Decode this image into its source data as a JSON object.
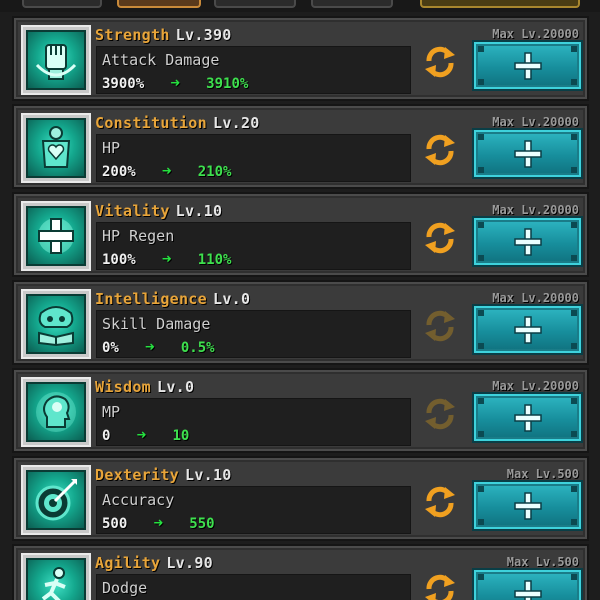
{
  "colors": {
    "stat_name": "#e8a53a",
    "next_value": "#3ee04e",
    "button": "#178e9c",
    "cycle_active": "#f0a020"
  },
  "stats": [
    {
      "name": "Strength",
      "level": "Lv.390",
      "max_level": "Max Lv.20000",
      "effect": "Attack Damage",
      "current": "3900%",
      "next": "3910%",
      "icon": "fist-icon",
      "cycle_active": true
    },
    {
      "name": "Constitution",
      "level": "Lv.20",
      "max_level": "Max Lv.20000",
      "effect": "HP",
      "current": "200%",
      "next": "210%",
      "icon": "heart-body-icon",
      "cycle_active": true
    },
    {
      "name": "Vitality",
      "level": "Lv.10",
      "max_level": "Max Lv.20000",
      "effect": "HP Regen",
      "current": "100%",
      "next": "110%",
      "icon": "holy-cross-icon",
      "cycle_active": true
    },
    {
      "name": "Intelligence",
      "level": "Lv.0",
      "max_level": "Max Lv.20000",
      "effect": "Skill Damage",
      "current": "0%",
      "next": "0.5%",
      "icon": "tree-book-icon",
      "cycle_active": false
    },
    {
      "name": "Wisdom",
      "level": "Lv.0",
      "max_level": "Max Lv.20000",
      "effect": "MP",
      "current": "0",
      "next": "10",
      "icon": "mind-head-icon",
      "cycle_active": false
    },
    {
      "name": "Dexterity",
      "level": "Lv.10",
      "max_level": "Max Lv.500",
      "effect": "Accuracy",
      "current": "500",
      "next": "550",
      "icon": "bullseye-icon",
      "cycle_active": true
    },
    {
      "name": "Agility",
      "level": "Lv.90",
      "max_level": "Max Lv.500",
      "effect": "Dodge",
      "current": "",
      "next": "",
      "icon": "running-figure-icon",
      "cycle_active": true
    }
  ]
}
